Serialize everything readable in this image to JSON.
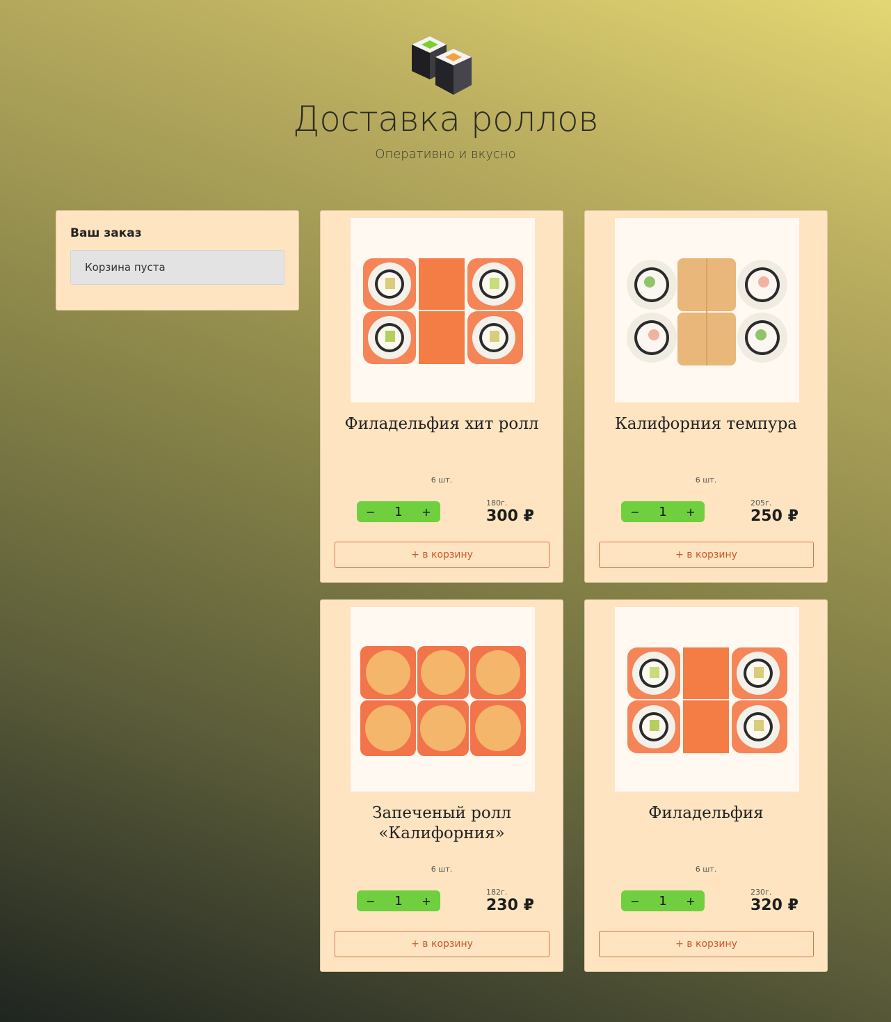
{
  "header": {
    "logo_icon": "sushi-rolls-icon",
    "title": "Доставка роллов",
    "subtitle": "Оперативно и вкусно"
  },
  "order": {
    "title": "Ваш заказ",
    "empty_text": "Корзина пуста"
  },
  "products": [
    {
      "name": "Филадельфия хит ролл",
      "count": "6 шт.",
      "quantity": "1",
      "weight": "180г.",
      "price": "300 ₽",
      "add_label": "+ в корзину",
      "decrement": "−",
      "increment": "+"
    },
    {
      "name": "Калифорния темпура",
      "count": "6 шт.",
      "quantity": "1",
      "weight": "205г.",
      "price": "250 ₽",
      "add_label": "+ в корзину",
      "decrement": "−",
      "increment": "+"
    },
    {
      "name": "Запеченый ролл «Калифорния»",
      "count": "6 шт.",
      "quantity": "1",
      "weight": "182г.",
      "price": "230 ₽",
      "add_label": "+ в корзину",
      "decrement": "−",
      "increment": "+"
    },
    {
      "name": "Филадельфия",
      "count": "6 шт.",
      "quantity": "1",
      "weight": "230г.",
      "price": "320 ₽",
      "add_label": "+ в корзину",
      "decrement": "−",
      "increment": "+"
    }
  ],
  "colors": {
    "card_bg": "#ffe4c1",
    "stepper_green": "#6fcf3e",
    "accent_orange": "#c9592e"
  }
}
